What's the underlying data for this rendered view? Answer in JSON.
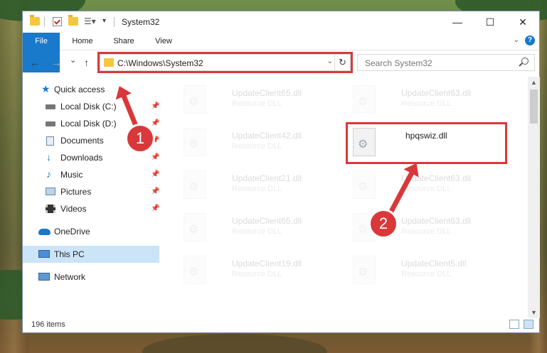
{
  "window": {
    "title": "System32",
    "controls": {
      "minimize": "—",
      "maximize": "☐",
      "close": "✕"
    }
  },
  "ribbon": {
    "tabs": [
      {
        "label": "File"
      },
      {
        "label": "Home"
      },
      {
        "label": "Share"
      },
      {
        "label": "View"
      }
    ],
    "help": "?"
  },
  "nav": {
    "back": "←",
    "forward": "→",
    "recent": "⌄",
    "up": "↑",
    "address": "C:\\Windows\\System32",
    "search_placeholder": "Search System32"
  },
  "sidebar": {
    "items": [
      {
        "label": "Quick access",
        "icon": "star-icon"
      },
      {
        "label": "Local Disk (C:)",
        "icon": "drive-icon",
        "pinned": true
      },
      {
        "label": "Local Disk (D:)",
        "icon": "drive-icon",
        "pinned": true
      },
      {
        "label": "Documents",
        "icon": "documents-icon",
        "pinned": true
      },
      {
        "label": "Downloads",
        "icon": "download-icon",
        "pinned": true
      },
      {
        "label": "Music",
        "icon": "music-icon",
        "pinned": true
      },
      {
        "label": "Pictures",
        "icon": "pictures-icon",
        "pinned": true
      },
      {
        "label": "Videos",
        "icon": "video-icon",
        "pinned": true
      },
      {
        "label": "OneDrive",
        "icon": "cloud-icon"
      },
      {
        "label": "This PC",
        "icon": "computer-icon",
        "selected": true
      },
      {
        "label": "Network",
        "icon": "network-icon"
      }
    ]
  },
  "files": [
    {
      "name": "UpdateClient65.dll",
      "desc": "Resource DLL"
    },
    {
      "name": "UpdateClient63.dll",
      "desc": "Resource DLL"
    },
    {
      "name": "UpdateClient42.dll",
      "desc": "Resource DLL"
    },
    {
      "name": "hpqswiz.dll",
      "desc": ""
    },
    {
      "name": "UpdateClient21.dll",
      "desc": "Resource DLL"
    },
    {
      "name": "UpdateClient63.dll",
      "desc": "Resource DLL"
    },
    {
      "name": "UpdateClient65.dll",
      "desc": "Resource DLL"
    },
    {
      "name": "UpdateClient63.dll",
      "desc": "Resource DLL"
    },
    {
      "name": "UpdateClient19.dll",
      "desc": "Resource DLL"
    },
    {
      "name": "UpdateClient5.dll",
      "desc": "Resource DLL"
    }
  ],
  "status": {
    "items": "196 items"
  },
  "callouts": [
    "1",
    "2"
  ],
  "colors": {
    "accent": "#1979ca",
    "highlight": "#d9383b",
    "selected": "#cce4f7"
  }
}
